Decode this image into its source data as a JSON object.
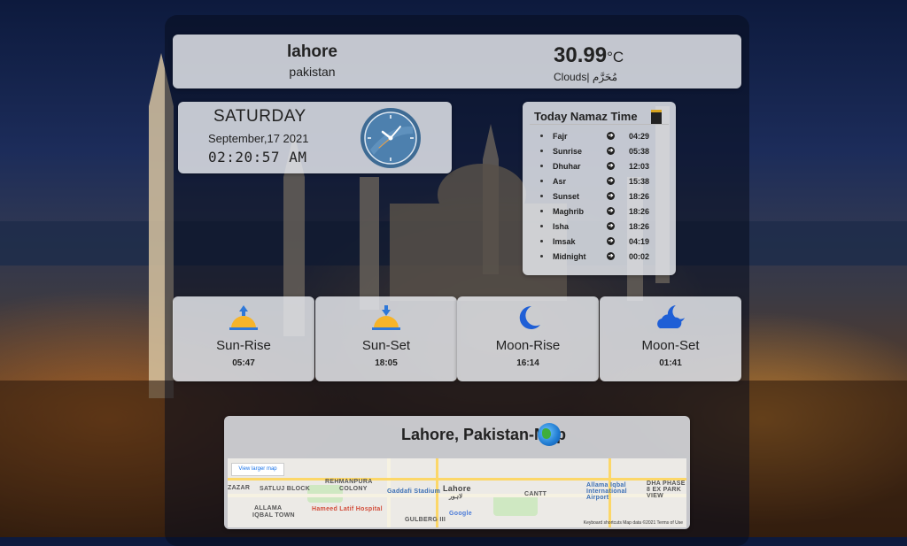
{
  "location": {
    "city": "lahore",
    "country": "pakistan"
  },
  "weather": {
    "temperature": "30.99",
    "unit": "°C",
    "condition": "Clouds| مُحَرَّم"
  },
  "datetime": {
    "day": "SATURDAY",
    "date": "September,17 2021",
    "time": "02:20:57 AM"
  },
  "namaz": {
    "title": "Today Namaz Time",
    "items": [
      {
        "name": "Fajr",
        "time": "04:29"
      },
      {
        "name": "Sunrise",
        "time": "05:38"
      },
      {
        "name": "Dhuhar",
        "time": "12:03"
      },
      {
        "name": "Asr",
        "time": "15:38"
      },
      {
        "name": "Sunset",
        "time": "18:26"
      },
      {
        "name": "Maghrib",
        "time": "18:26"
      },
      {
        "name": "Isha",
        "time": "18:26"
      },
      {
        "name": "Imsak",
        "time": "04:19"
      },
      {
        "name": "Midnight",
        "time": "00:02"
      }
    ]
  },
  "astro": {
    "sunrise": {
      "label": "Sun-Rise",
      "time": "05:47",
      "icon": "sunrise-icon"
    },
    "sunset": {
      "label": "Sun-Set",
      "time": "18:05",
      "icon": "sunset-icon"
    },
    "moonrise": {
      "label": "Moon-Rise",
      "time": "16:14",
      "icon": "moon-icon"
    },
    "moonset": {
      "label": "Moon-Set",
      "time": "01:41",
      "icon": "cloud-moon-icon"
    }
  },
  "map": {
    "title": "Lahore, Pakistan-Map",
    "view_larger": "View larger map",
    "labels": {
      "rehmanpura": "REHMANPURA",
      "colony": "COLONY",
      "satluj": "SATLUJ BLOCK",
      "allama": "ALLAMA",
      "iqbal_town": "IQBAL TOWN",
      "gaddafi": "Gaddafi Stadium",
      "lahore": "Lahore",
      "lahore_ur": "لاہور",
      "cantt": "CANTT",
      "airport": "Allama Iqbal International Airport",
      "dha": "DHA PHASE 8 EX PARK VIEW",
      "hospital": "Hameed Latif Hospital",
      "gulberg": "GULBERG III",
      "google": "Google",
      "zazar": "ZAZAR"
    },
    "footer": "Keyboard shortcuts   Map data ©2021   Terms of Use"
  }
}
